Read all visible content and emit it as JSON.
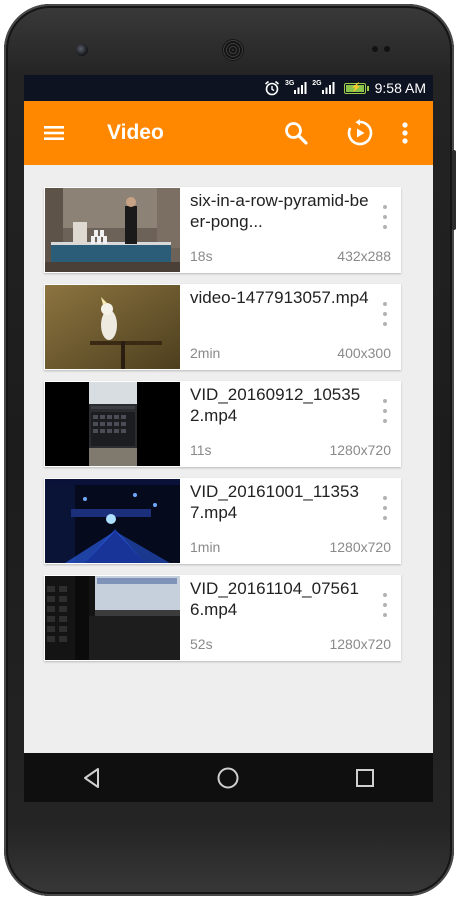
{
  "status_bar": {
    "network_1": "3G",
    "network_2": "2G",
    "time": "9:58 AM",
    "icons": [
      "alarm-icon",
      "signal-icon",
      "signal-icon",
      "battery-charging-icon"
    ]
  },
  "toolbar": {
    "title": "Video",
    "icons": [
      "menu-icon",
      "search-icon",
      "resume-playback-icon",
      "more-vert-icon"
    ],
    "background": "#ff8800"
  },
  "videos": [
    {
      "title": "six-in-a-row-pyramid-beer-pong...",
      "duration": "18s",
      "resolution": "432x288",
      "thumbnail": "beer-pong-scene"
    },
    {
      "title": "video-1477913057.mp4",
      "duration": "2min",
      "resolution": "400x300",
      "thumbnail": "cockatoo-on-perch"
    },
    {
      "title": "VID_20160912_105352.mp4",
      "duration": "11s",
      "resolution": "1280x720",
      "thumbnail": "laptop-keyboard-vertical"
    },
    {
      "title": "VID_20161001_113537.mp4",
      "duration": "1min",
      "resolution": "1280x720",
      "thumbnail": "blue-stage-lights"
    },
    {
      "title": "VID_20161104_075616.mp4",
      "duration": "52s",
      "resolution": "1280x720",
      "thumbnail": "laptop-keyboard-screen"
    }
  ],
  "nav_bar": {
    "icons": [
      "back-icon",
      "home-icon",
      "recents-icon"
    ]
  },
  "colors": {
    "accent": "#ff8800",
    "status_bar": "#0d1320",
    "list_background": "#eeeeee"
  }
}
